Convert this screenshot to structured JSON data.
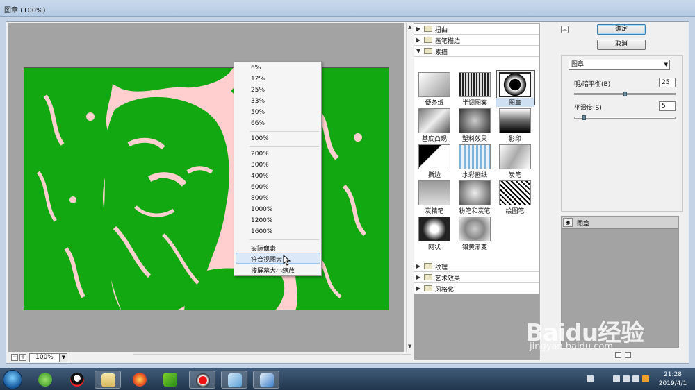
{
  "window": {
    "title": "图章 (100%)"
  },
  "preview": {
    "zoom_value": "100%"
  },
  "zoom_menu": {
    "group1": [
      "6%",
      "12%",
      "25%",
      "33%",
      "50%",
      "66%"
    ],
    "group2": [
      "100%"
    ],
    "group3": [
      "200%",
      "300%",
      "400%",
      "600%",
      "800%",
      "1000%",
      "1200%",
      "1600%"
    ],
    "group4": [
      "实际像素",
      "符合视图大",
      "按屏幕大小缩放"
    ],
    "highlighted": "符合视图大"
  },
  "gallery": {
    "categories_top": [
      "扭曲",
      "画笔描边",
      "素描"
    ],
    "expanded_category": "素描",
    "filters": [
      "便条纸",
      "半调图案",
      "图章",
      "基底凸现",
      "塑料效果",
      "影印",
      "撕边",
      "水彩画纸",
      "炭笔",
      "炭精笔",
      "粉笔和炭笔",
      "绘图笔",
      "网状",
      "铬黄渐变"
    ],
    "selected_filter": "图章",
    "categories_bottom": [
      "纹理",
      "艺术效果",
      "风格化"
    ]
  },
  "settings": {
    "ok_label": "确定",
    "cancel_label": "取消",
    "filter_select": "图章",
    "param1": {
      "label": "明/暗平衡(B)",
      "value": "25",
      "fraction": 0.5
    },
    "param2": {
      "label": "平滑度(S)",
      "value": "5",
      "fraction": 0.08
    }
  },
  "layers": {
    "items": [
      "图章"
    ]
  },
  "taskbar": {
    "apps": [
      "360-browser",
      "qq",
      "explorer",
      "firefox",
      "iqiyi",
      "recorder",
      "word",
      "photoshop-ink"
    ],
    "time": "21:28",
    "date": "2019/4/1"
  },
  "watermark": {
    "logo": "Baidu经验",
    "site": "jingyan.baidu.com"
  },
  "colors": {
    "artwork_bg": "#ffcfcf",
    "artwork_fg": "#11a811"
  }
}
